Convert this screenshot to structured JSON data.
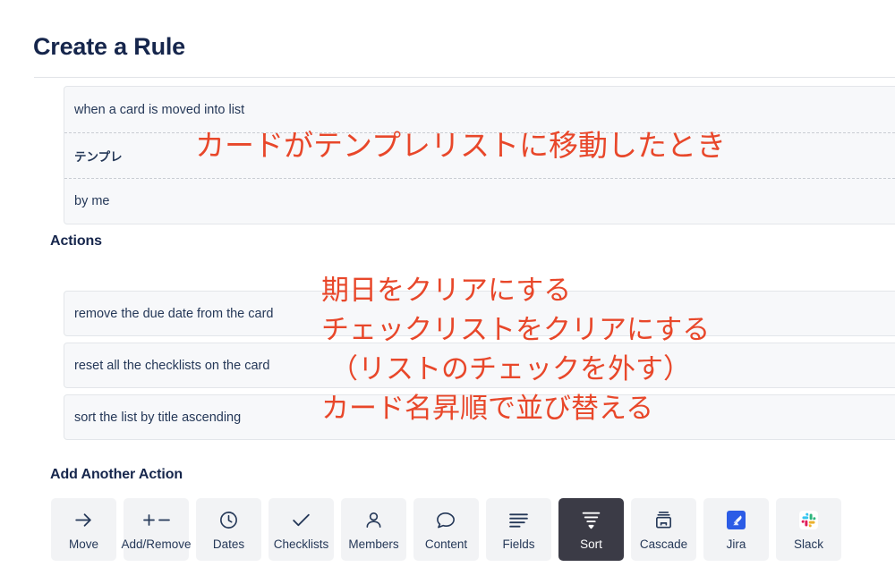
{
  "page": {
    "title": "Create a Rule"
  },
  "trigger": {
    "rows": [
      {
        "text": "when a card is moved into list",
        "style": "en"
      },
      {
        "text": "テンプレ",
        "style": "jp"
      },
      {
        "text": "by me",
        "style": "en"
      }
    ],
    "annotation": "カードがテンプレリストに移動したとき"
  },
  "actions": {
    "heading": "Actions",
    "cards": [
      {
        "text": "remove the due date from the card"
      },
      {
        "text": "reset all the checklists on the card"
      },
      {
        "text": "sort the list by title ascending"
      }
    ],
    "annotations": [
      "期日をクリアにする",
      "チェックリストをクリアにする",
      "（リストのチェックを外す）",
      "カード名昇順で並び替える"
    ]
  },
  "add_another_action": {
    "heading": "Add Another Action",
    "buttons": [
      {
        "label": "Move",
        "icon": "arrow-right-icon",
        "selected": false
      },
      {
        "label": "Add/Remove",
        "icon": "plus-minus-icon",
        "selected": false
      },
      {
        "label": "Dates",
        "icon": "clock-icon",
        "selected": false
      },
      {
        "label": "Checklists",
        "icon": "check-icon",
        "selected": false
      },
      {
        "label": "Members",
        "icon": "person-icon",
        "selected": false
      },
      {
        "label": "Content",
        "icon": "speech-bubble-icon",
        "selected": false
      },
      {
        "label": "Fields",
        "icon": "lines-icon",
        "selected": false
      },
      {
        "label": "Sort",
        "icon": "funnel-icon",
        "selected": true
      },
      {
        "label": "Cascade",
        "icon": "archive-box-icon",
        "selected": false
      },
      {
        "label": "Jira",
        "icon": "jira-logo-icon",
        "selected": false
      },
      {
        "label": "Slack",
        "icon": "slack-logo-icon",
        "selected": false
      }
    ]
  },
  "colors": {
    "annotation_red": "#e8472a",
    "heading_navy": "#16264c",
    "card_background": "#f7f8fa",
    "selected_button": "#3b3b46",
    "jira_blue": "#2c5ce6"
  }
}
